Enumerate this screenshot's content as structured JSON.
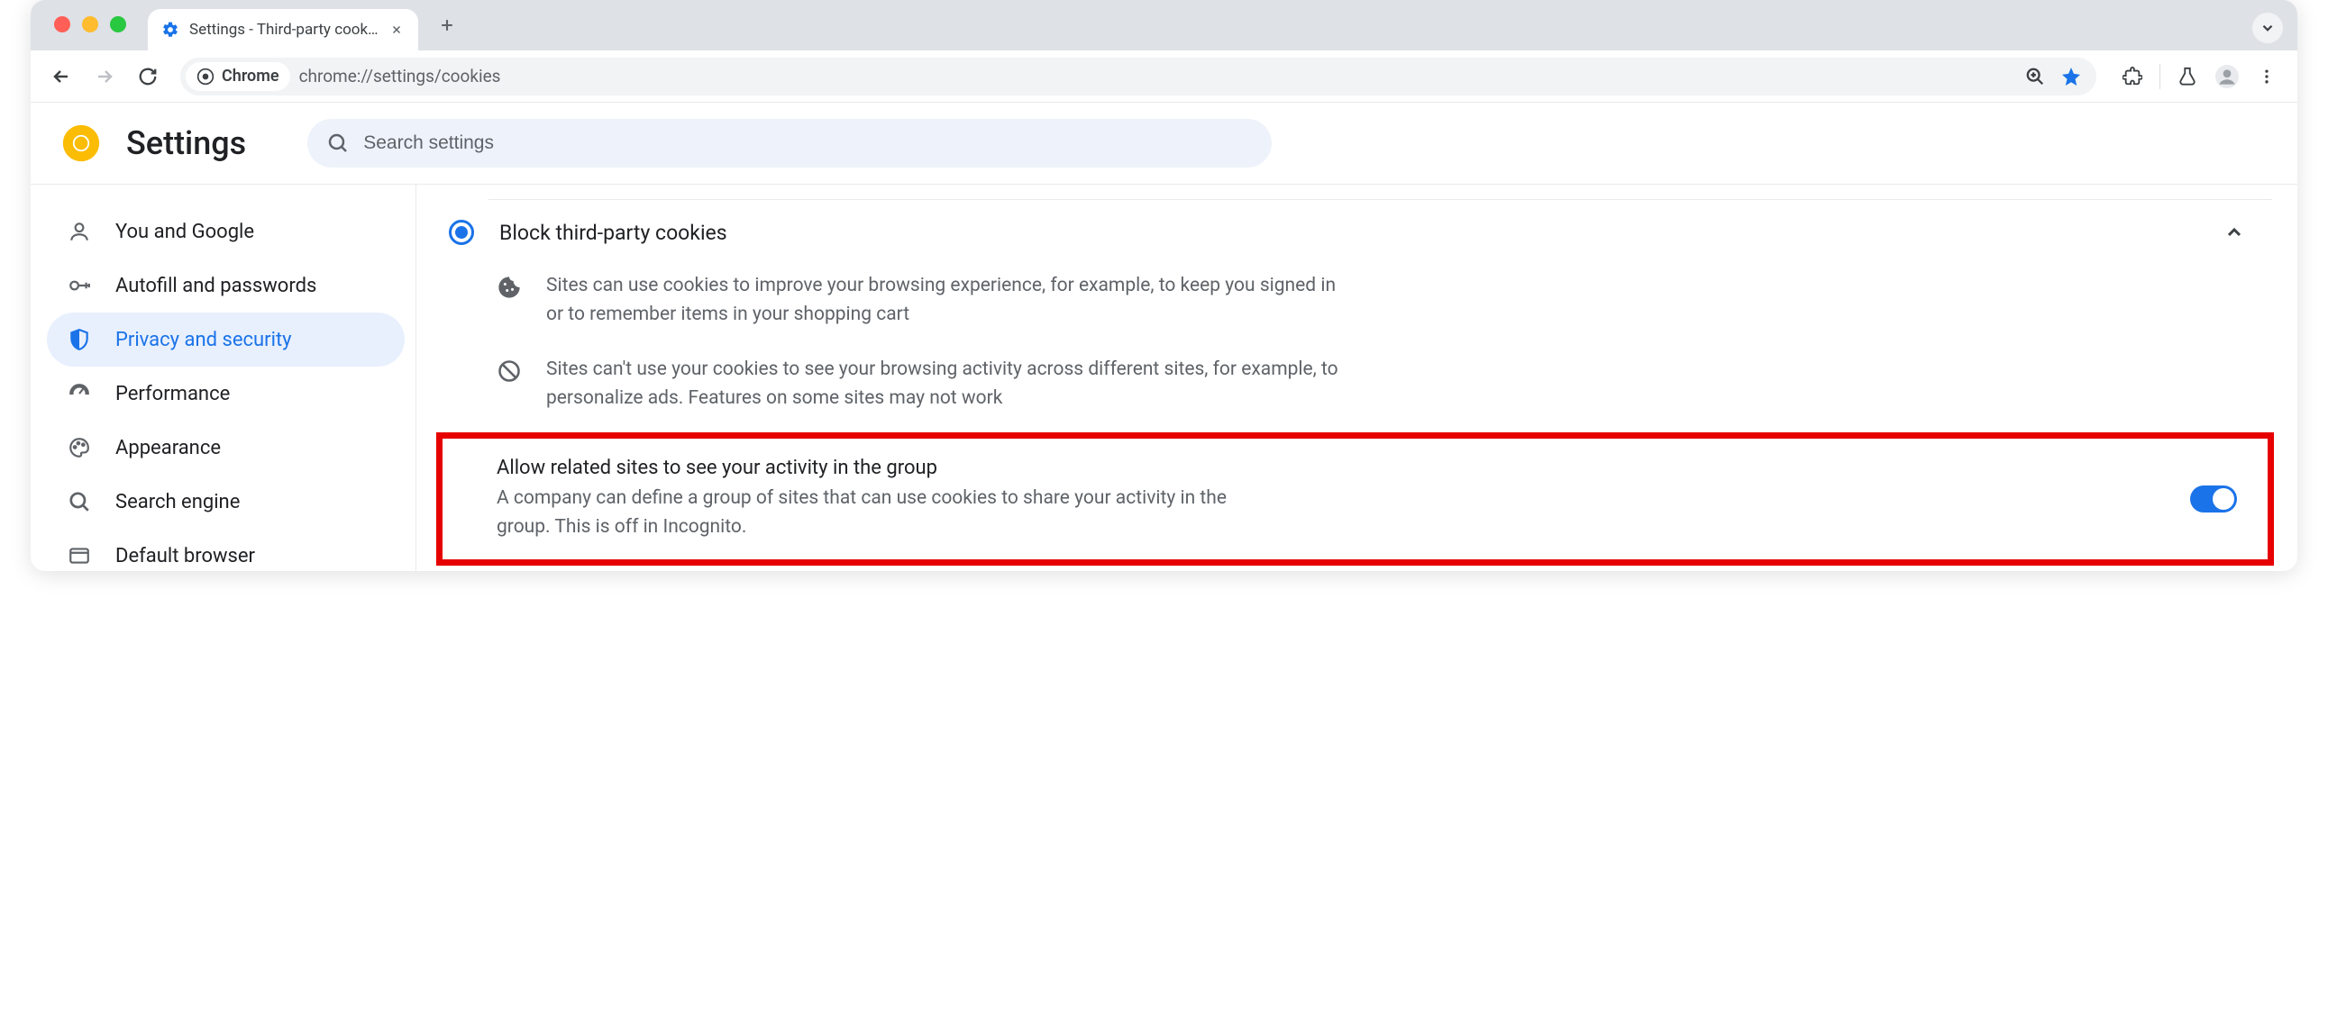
{
  "window": {
    "tab_title": "Settings - Third-party cookies"
  },
  "toolbar": {
    "site_chip_label": "Chrome",
    "url": "chrome://settings/cookies"
  },
  "settings_header": {
    "title": "Settings",
    "search_placeholder": "Search settings"
  },
  "sidebar": {
    "items": [
      {
        "label": "You and Google",
        "icon": "person"
      },
      {
        "label": "Autofill and passwords",
        "icon": "key"
      },
      {
        "label": "Privacy and security",
        "icon": "shield",
        "selected": true
      },
      {
        "label": "Performance",
        "icon": "speed"
      },
      {
        "label": "Appearance",
        "icon": "palette"
      },
      {
        "label": "Search engine",
        "icon": "search"
      },
      {
        "label": "Default browser",
        "icon": "browser"
      }
    ]
  },
  "option": {
    "title": "Block third-party cookies",
    "desc1": "Sites can use cookies to improve your browsing experience, for example, to keep you signed in or to remember items in your shopping cart",
    "desc2": "Sites can't use your cookies to see your browsing activity across different sites, for example, to personalize ads. Features on some sites may not work"
  },
  "highlight": {
    "title": "Allow related sites to see your activity in the group",
    "desc": "A company can define a group of sites that can use cookies to share your activity in the group. This is off in Incognito.",
    "toggle_on": true
  },
  "colors": {
    "accent": "#1a73e8",
    "highlight_border": "#e60000"
  }
}
